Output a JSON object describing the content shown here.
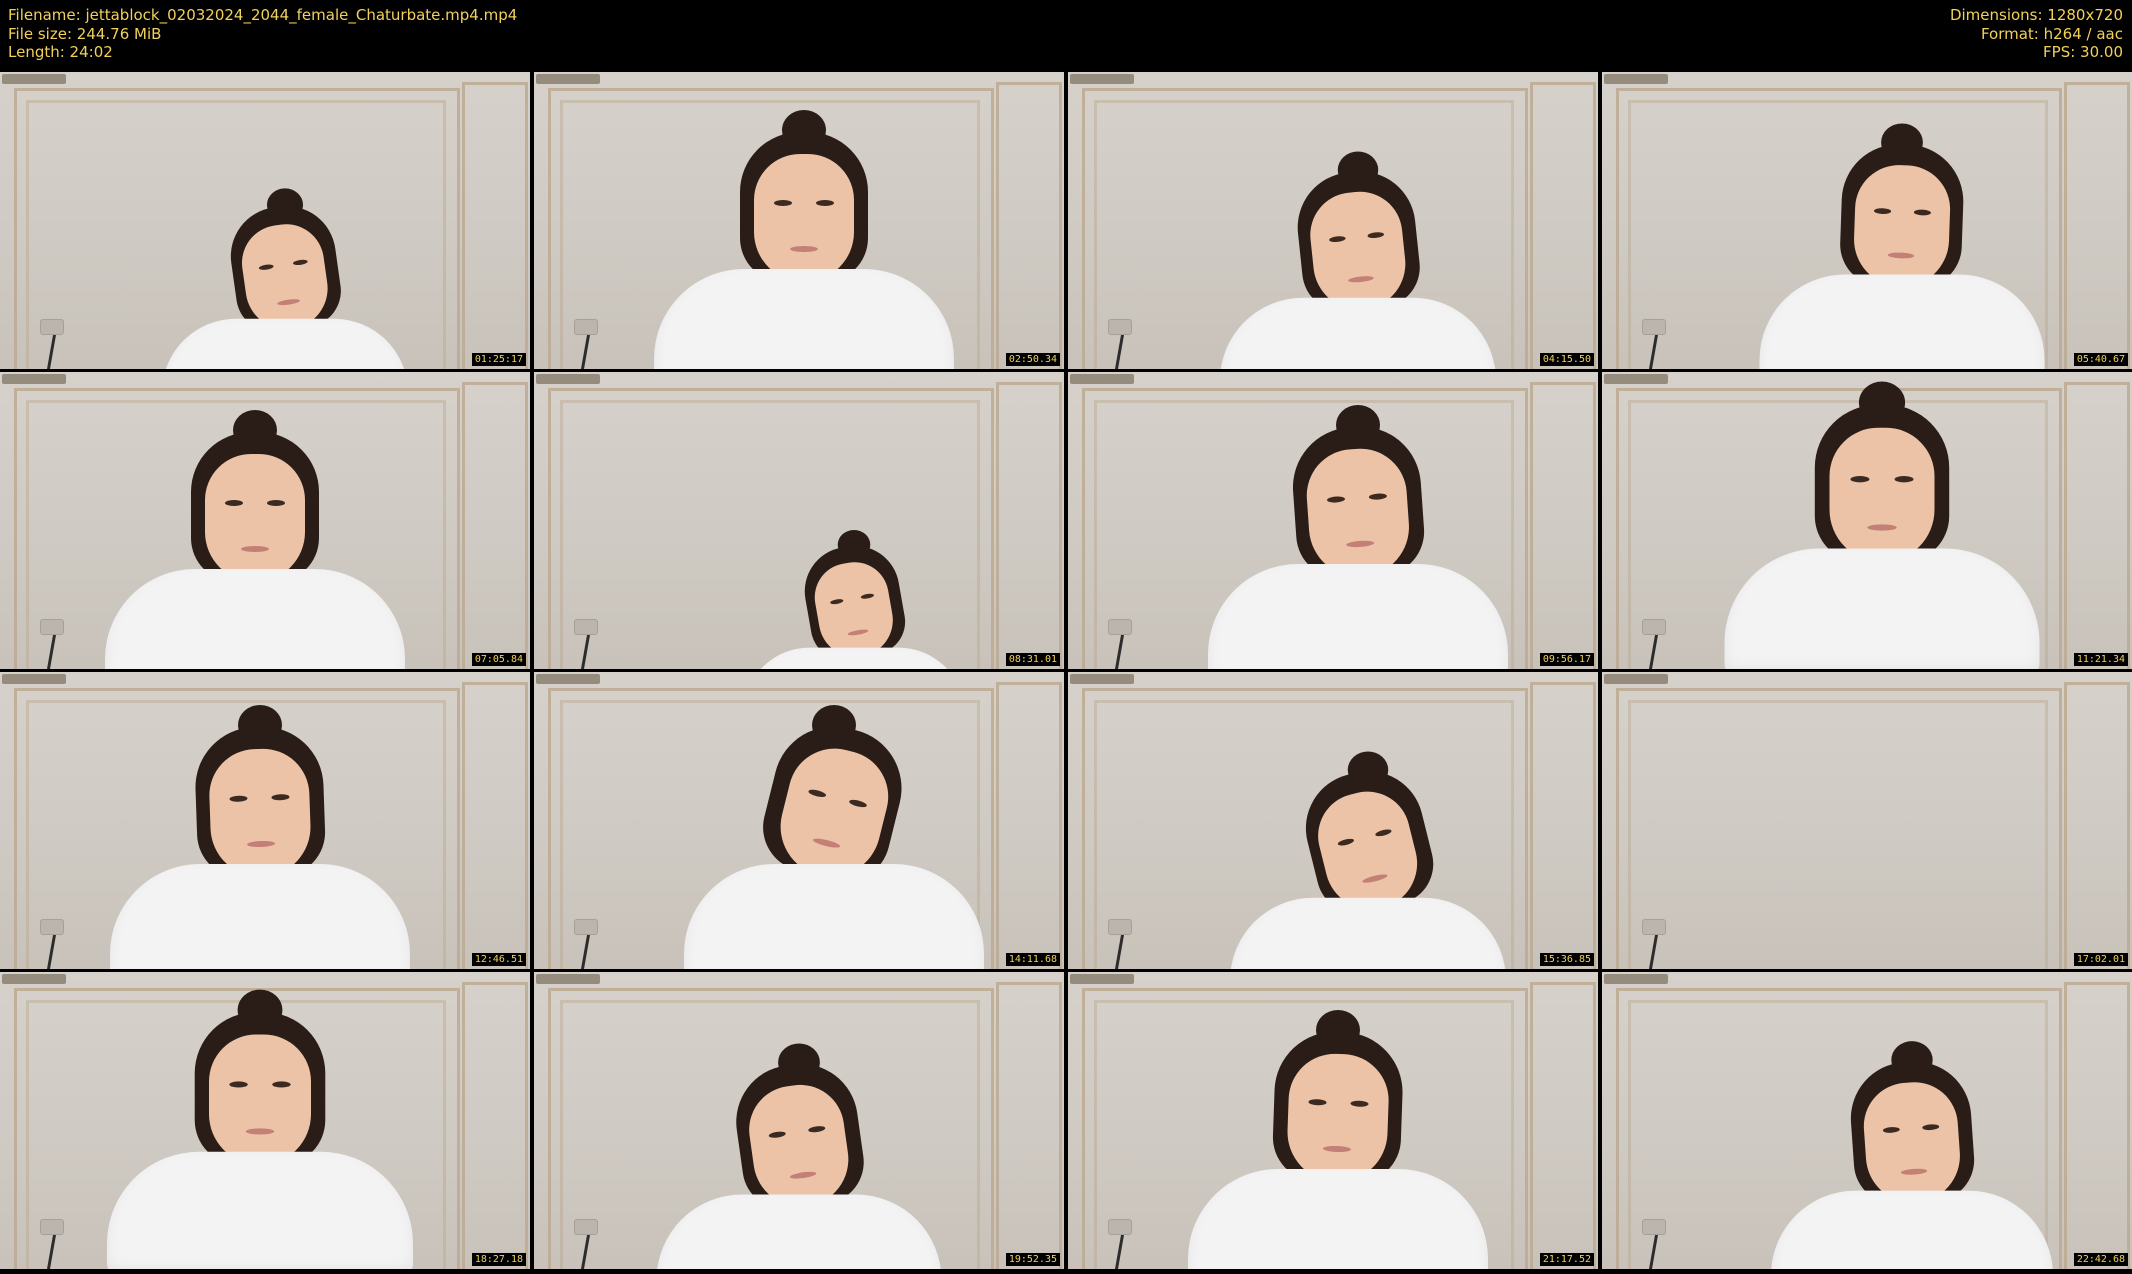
{
  "header": {
    "filename": "Filename: jettablock_02032024_2044_female_Chaturbate.mp4.mp4",
    "filesize": "File size: 244.76 MiB",
    "length": "Length: 24:02",
    "dimensions": "Dimensions: 1280x720",
    "format": "Format: h264 / aac",
    "fps": "FPS: 30.00"
  },
  "colors": {
    "background": "#000000",
    "meta_text": "#f2d15a",
    "wall": "#d2cdc7",
    "frame_molding": "#bba98f",
    "shirt": "#f3f3f4",
    "hair": "#2a1d18"
  },
  "frames": [
    {
      "timestamp": "01:25:17"
    },
    {
      "timestamp": "02:50.34"
    },
    {
      "timestamp": "04:15.50"
    },
    {
      "timestamp": "05:40.67"
    },
    {
      "timestamp": "07:05.84"
    },
    {
      "timestamp": "08:31.01"
    },
    {
      "timestamp": "09:56.17"
    },
    {
      "timestamp": "11:21.34"
    },
    {
      "timestamp": "12:46.51"
    },
    {
      "timestamp": "14:11.68"
    },
    {
      "timestamp": "15:36.85"
    },
    {
      "timestamp": "17:02.01"
    },
    {
      "timestamp": "18:27.18"
    },
    {
      "timestamp": "19:52.35"
    },
    {
      "timestamp": "21:17.52"
    },
    {
      "timestamp": "22:42.68"
    }
  ]
}
